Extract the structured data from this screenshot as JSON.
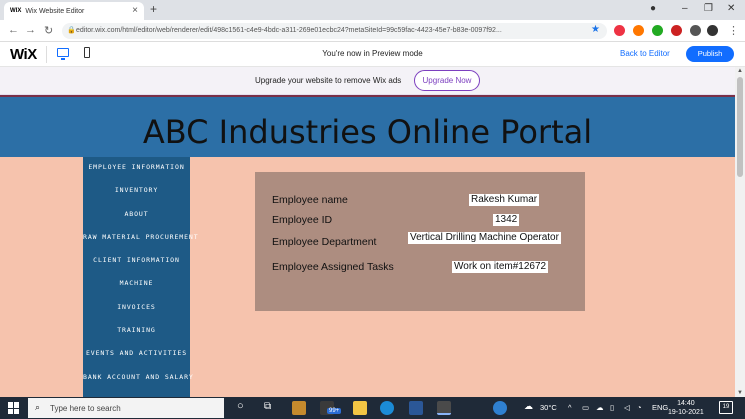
{
  "browser": {
    "tab_title": "Wix Website Editor",
    "tab_favicon": "WIX",
    "url": "editor.wix.com/html/editor/web/renderer/edit/498c1561-c4e9-4bdc-a311-269e01ecbc24?metaSiteId=99c59fac-4423-45e7-b83e-0097f92..."
  },
  "wix_bar": {
    "logo": "WiX",
    "preview_message": "You're now in Preview mode",
    "back_to_editor": "Back to Editor",
    "publish": "Publish"
  },
  "upgrade_bar": {
    "text": "Upgrade your website to remove Wix ads",
    "button": "Upgrade Now"
  },
  "site": {
    "title": "ABC Industries Online Portal",
    "menu": [
      "EMPLOYEE INFORMATION",
      "INVENTORY",
      "ABOUT",
      "RAW MATERIAL PROCUREMENT",
      "CLIENT INFORMATION",
      "MACHINE",
      "INVOICES",
      "TRAINING",
      "EVENTS AND ACTIVITIES",
      "BANK ACCOUNT AND SALARY"
    ],
    "employee": {
      "name_label": "Employee name",
      "name_value": "Rakesh Kumar",
      "id_label": "Employee ID",
      "id_value": "1342",
      "dept_label": "Employee Department",
      "dept_value": "Vertical Drilling Machine Operator",
      "tasks_label": "Employee Assigned Tasks",
      "tasks_value": "Work on item#12672"
    },
    "colors": {
      "background": "#f6c3ad",
      "header": "#2c6fa6",
      "menu": "#1e5a86",
      "card": "#ad8d80"
    }
  },
  "taskbar": {
    "search_placeholder": "Type here to search",
    "badge": "99+",
    "temperature": "30°C",
    "language": "ENG",
    "time": "14:40",
    "date": "19-10-2021",
    "notifications": "19"
  }
}
